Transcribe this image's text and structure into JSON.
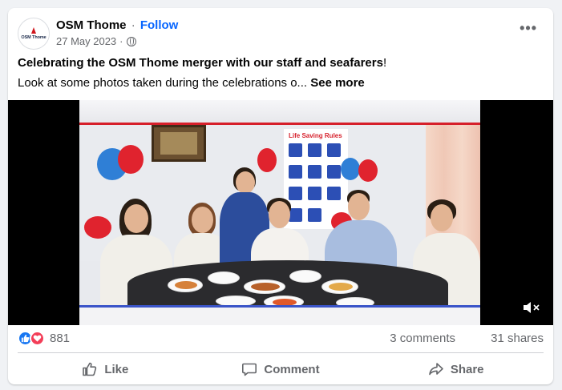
{
  "post": {
    "page_name": "OSM Thome",
    "separator": "·",
    "follow_label": "Follow",
    "date": "27 May 2023",
    "avatar_text": "OSM Thome",
    "caption_bold": "Celebrating the OSM Thome merger with our staff and seafarers",
    "caption_bold_suffix": "!",
    "caption_text": "Look at some photos taken during the celebrations o...",
    "see_more_label": "See more",
    "video_poster_title": "Life Saving Rules"
  },
  "stats": {
    "reaction_count": "881",
    "comments": "3 comments",
    "shares": "31 shares"
  },
  "actions": {
    "like": "Like",
    "comment": "Comment",
    "share": "Share"
  },
  "icons": {
    "more": "more-options-icon",
    "privacy": "globe-icon",
    "mute": "muted-speaker-icon",
    "like": "thumbs-up-icon",
    "comment": "speech-bubble-icon",
    "share": "share-arrow-icon"
  },
  "colors": {
    "brand_blue": "#0866ff",
    "like_blue": "#1877f2",
    "love_red": "#f33e58",
    "secondary_text": "#65676b"
  }
}
